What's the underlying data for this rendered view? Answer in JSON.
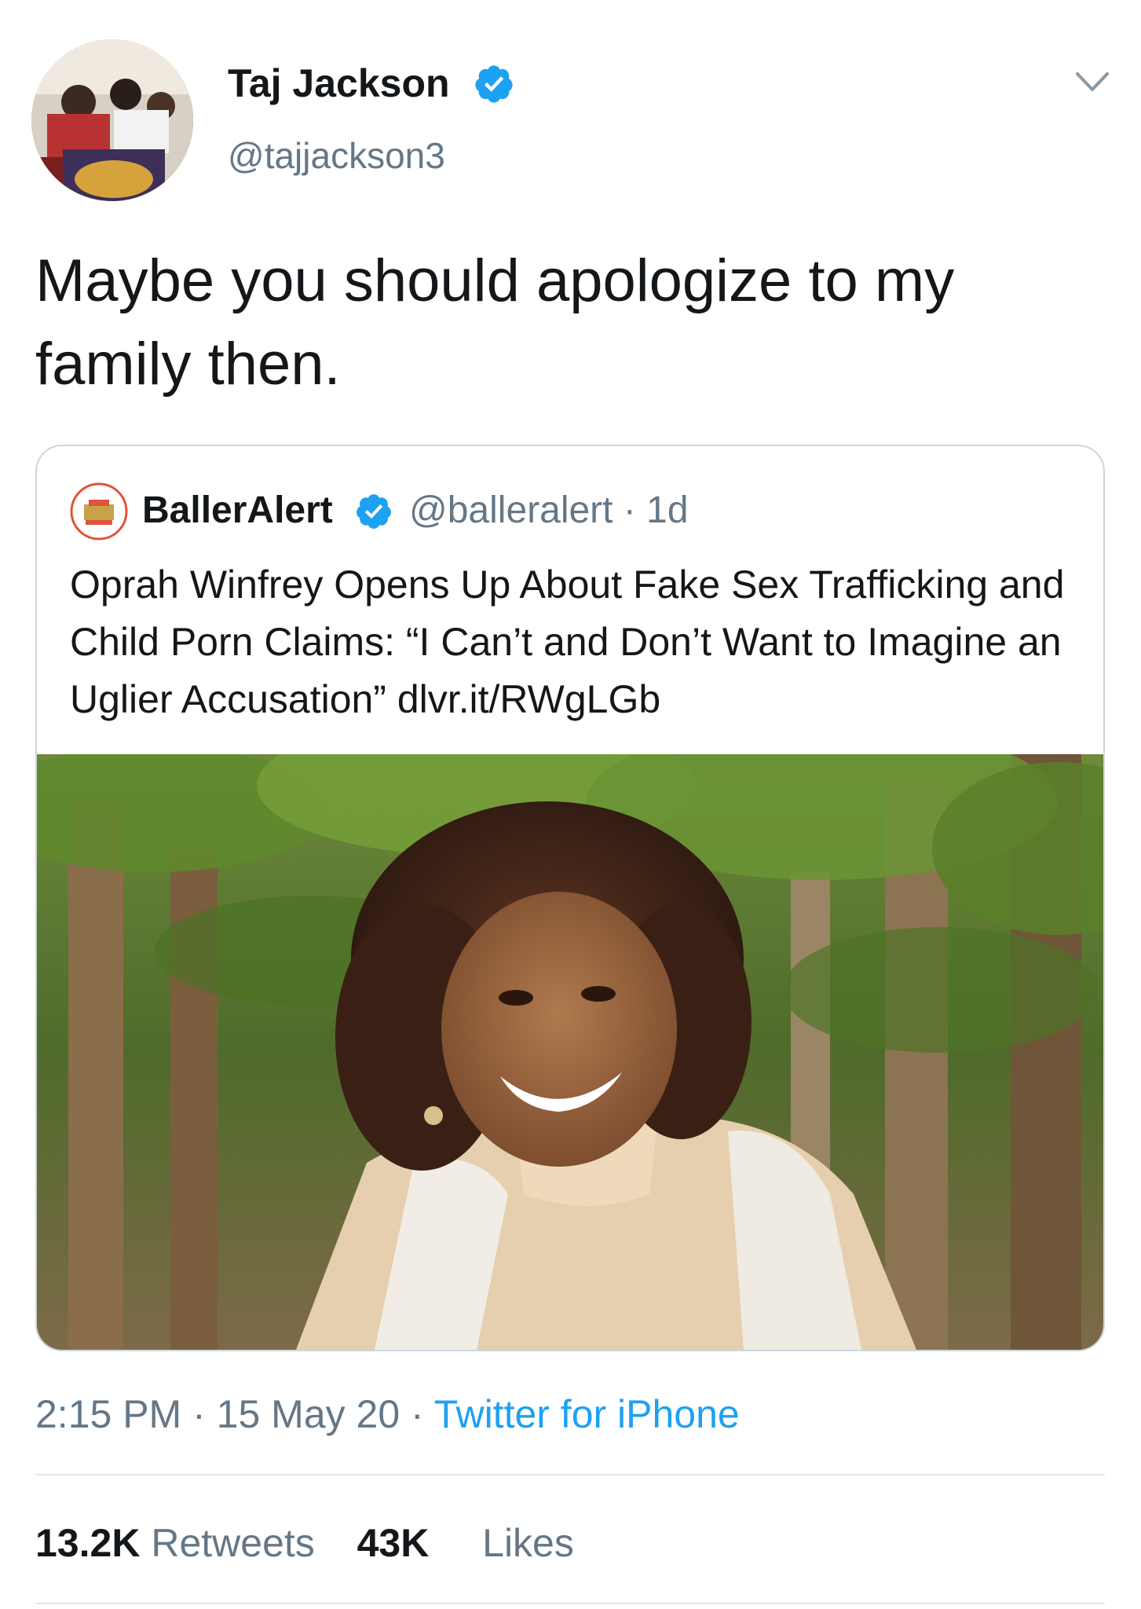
{
  "tweet": {
    "author": {
      "name": "Taj Jackson",
      "handle": "@tajjackson3",
      "verified": true
    },
    "text": "Maybe you should apologize to my family then.",
    "quoted": {
      "author_name": "BallerAlert",
      "author_handle_time": "@balleralert · 1d",
      "verified": true,
      "text": "Oprah Winfrey Opens Up About Fake Sex Trafficking and Child Porn Claims: “I Can’t and Don’t Want to Imagine an Uglier Accusation” dlvr.it/RWgLGb"
    },
    "meta": {
      "time": "2:15 PM",
      "date": "15 May 20",
      "source": "Twitter for iPhone",
      "sep": " · "
    },
    "stats": {
      "retweets_count": "13.2K",
      "retweets_label": "Retweets",
      "likes_count": "43K",
      "likes_label": "Likes"
    }
  },
  "colors": {
    "text": "#14171a",
    "secondary": "#657786",
    "link": "#1da1f2",
    "border": "#ccd6dd",
    "verified": "#1da1f2"
  }
}
